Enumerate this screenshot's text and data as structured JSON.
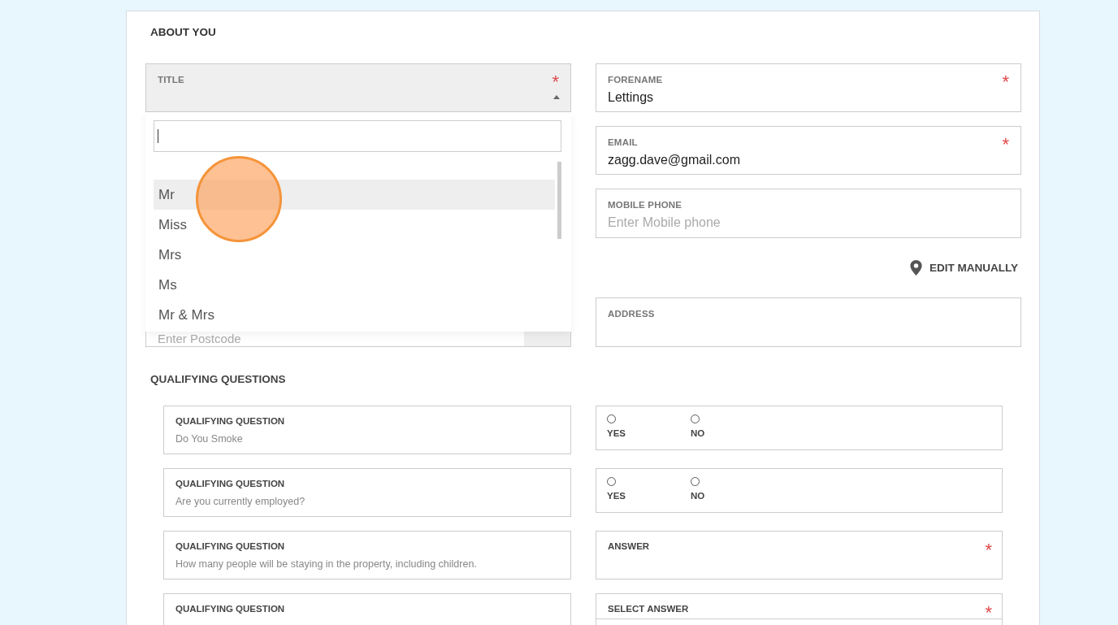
{
  "about": {
    "heading": "ABOUT YOU"
  },
  "title_field": {
    "label": "TITLE",
    "required_mark": "*",
    "expanded": true,
    "options": [
      {
        "label": "Mr",
        "selected": true
      },
      {
        "label": "Miss",
        "selected": false
      },
      {
        "label": "Mrs",
        "selected": false
      },
      {
        "label": "Ms",
        "selected": false
      },
      {
        "label": "Mr & Mrs",
        "selected": false
      }
    ]
  },
  "fields": [
    {
      "label": "FORENAME",
      "value": "Lettings",
      "required_mark": "*"
    },
    {
      "label": "EMAIL",
      "value": "zagg.dave@gmail.com",
      "required_mark": "*"
    },
    {
      "label": "MOBILE PHONE",
      "placeholder": "Enter Mobile phone"
    }
  ],
  "edit_manually": {
    "label": "EDIT MANUALLY"
  },
  "postcode": {
    "placeholder": "Enter Postcode"
  },
  "address": {
    "label": "ADDRESS"
  },
  "qualifying": {
    "heading": "QUALIFYING QUESTIONS",
    "questions": [
      {
        "label": "QUALIFYING QUESTION",
        "text": "Do You Smoke",
        "answer": {
          "kind": "radio",
          "options": [
            {
              "label": "YES",
              "selected": false
            },
            {
              "label": "NO",
              "selected": false
            }
          ]
        }
      },
      {
        "label": "QUALIFYING QUESTION",
        "text": "Are you currently employed?",
        "answer": {
          "kind": "radio",
          "options": [
            {
              "label": "YES",
              "selected": false
            },
            {
              "label": "NO",
              "selected": false
            }
          ]
        }
      },
      {
        "label": "QUALIFYING QUESTION",
        "text": "How many people will be staying in the property, including children.",
        "answer": {
          "kind": "text",
          "label": "ANSWER",
          "required_mark": "*"
        }
      },
      {
        "label": "QUALIFYING QUESTION",
        "answer": {
          "kind": "select",
          "label": "SELECT ANSWER",
          "required_mark": "*"
        }
      }
    ]
  }
}
